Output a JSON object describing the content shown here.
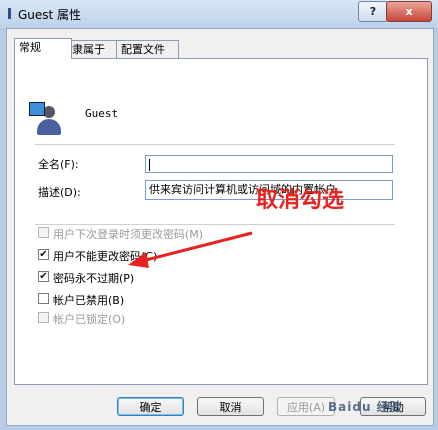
{
  "window": {
    "title": "Guest 属性",
    "help_button": "?",
    "close_button": "x"
  },
  "tabs": [
    "常规",
    "隶属于",
    "配置文件"
  ],
  "user": {
    "name": "Guest"
  },
  "fields": {
    "fullname_label": "全名(F):",
    "fullname_value": "",
    "description_label": "描述(D):",
    "description_value": "供来宾访问计算机或访问域的内置帐户"
  },
  "options": [
    {
      "label": "用户下次登录时须更改密码(M)",
      "checked": false,
      "disabled": true
    },
    {
      "label": "用户不能更改密码(C)",
      "checked": true,
      "disabled": false
    },
    {
      "label": "密码永不过期(P)",
      "checked": true,
      "disabled": false
    },
    {
      "label": "帐户已禁用(B)",
      "checked": false,
      "disabled": false
    },
    {
      "label": "帐户已锁定(O)",
      "checked": false,
      "disabled": true
    }
  ],
  "annotation": {
    "text": "取消勾选",
    "color": "#e8231f"
  },
  "buttons": {
    "ok": "确定",
    "cancel": "取消",
    "apply": "应用(A)",
    "help": "帮助"
  },
  "watermark": "Baidu 经验"
}
